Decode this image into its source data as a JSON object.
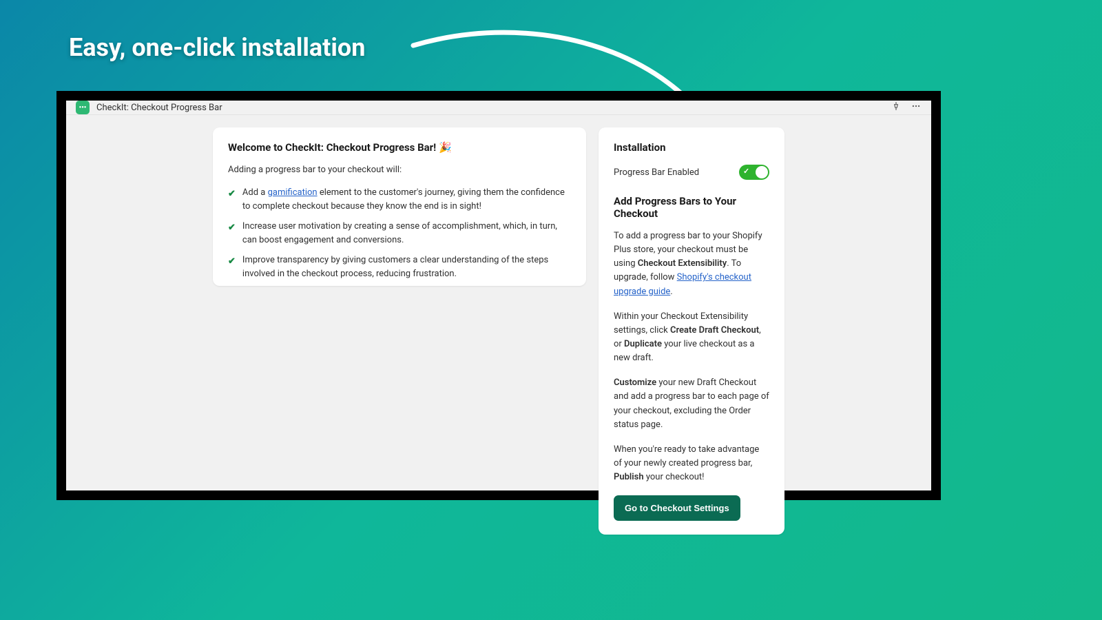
{
  "hero": "Easy, one-click installation",
  "topbar": {
    "app_name": "CheckIt: Checkout Progress Bar"
  },
  "welcome": {
    "title": "Welcome to CheckIt: Checkout Progress Bar! 🎉",
    "subtitle": "Adding a progress bar to your checkout will:",
    "benefits": {
      "b1_pre": "Add a ",
      "b1_link": "gamification",
      "b1_post": " element to the customer's journey, giving them the confidence to complete checkout because they know the end is in sight!",
      "b2": "Increase user motivation by creating a sense of accomplishment, which, in turn, can boost engagement and conversions.",
      "b3": "Improve transparency by giving customers a clear understanding of the steps involved in the checkout process, reducing frustration."
    }
  },
  "install": {
    "heading": "Installation",
    "toggle_label": "Progress Bar Enabled",
    "section_heading": "Add Progress Bars to Your Checkout",
    "p1_pre": "To add a progress bar to your Shopify Plus store, your checkout must be using ",
    "p1_strong": "Checkout Extensibility",
    "p1_mid": ". To upgrade, follow ",
    "p1_link": "Shopify's checkout upgrade guide",
    "p1_end": ".",
    "p2_pre": "Within your Checkout Extensibility settings, click ",
    "p2_s1": "Create Draft Checkout",
    "p2_mid": ", or ",
    "p2_s2": "Duplicate",
    "p2_end": " your live checkout as a new draft.",
    "p3_s1": "Customize",
    "p3_rest": " your new Draft Checkout and add a progress bar to each page of your checkout, excluding the Order status page.",
    "p4_pre": "When you're ready to take advantage of your newly created progress bar, ",
    "p4_s1": "Publish",
    "p4_end": " your checkout!",
    "cta": "Go to Checkout Settings"
  }
}
